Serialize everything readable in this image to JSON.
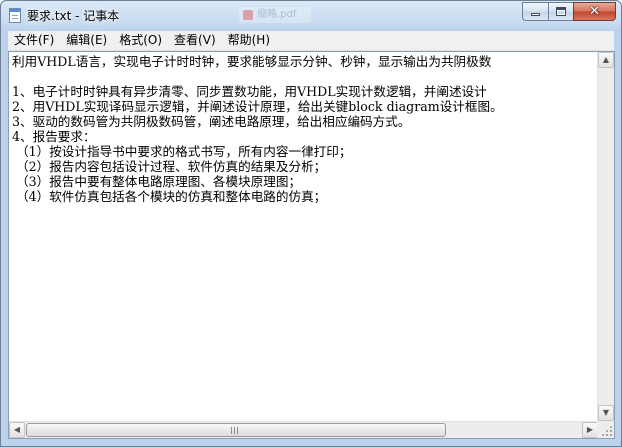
{
  "window": {
    "title": "要求.txt - 记事本",
    "background_tab_title": "缩略.pdf",
    "close_symbol": "✕"
  },
  "menu": [
    {
      "label": "文件(F)"
    },
    {
      "label": "编辑(E)"
    },
    {
      "label": "格式(O)"
    },
    {
      "label": "查看(V)"
    },
    {
      "label": "帮助(H)"
    }
  ],
  "document": {
    "lines": [
      "利用VHDL语言，实现电子计时时钟，要求能够显示分钟、秒钟，显示输出为共阴极数",
      "",
      "1、电子计时时钟具有异步清零、同步置数功能，用VHDL实现计数逻辑，并阐述设计",
      "2、用VHDL实现译码显示逻辑，并阐述设计原理，给出关键block diagram设计框图。",
      "3、驱动的数码管为共阴极数码管，阐述电路原理，给出相应编码方式。",
      "4、报告要求：",
      " （1）按设计指导书中要求的格式书写，所有内容一律打印；",
      " （2）报告内容包括设计过程、软件仿真的结果及分析；",
      " （3）报告中要有整体电路原理图、各模块原理图；",
      " （4）软件仿真包括各个模块的仿真和整体电路的仿真；"
    ]
  },
  "scrollbars": {
    "up_arrow": "▲",
    "down_arrow": "▼",
    "left_arrow": "◀",
    "right_arrow": "▶"
  }
}
